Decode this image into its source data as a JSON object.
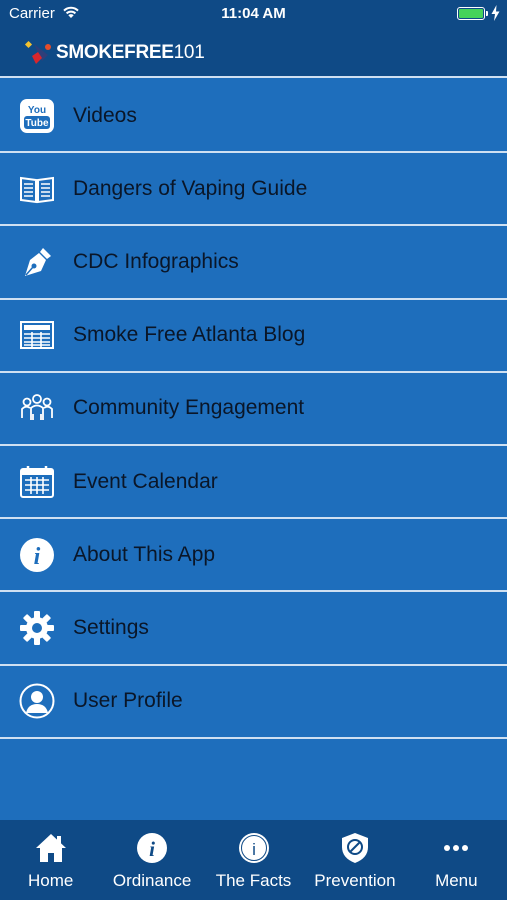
{
  "status_bar": {
    "carrier": "Carrier",
    "time": "11:04 AM",
    "battery_level": 1.0
  },
  "header": {
    "logo_text": "SMOKEFREE101"
  },
  "menu": {
    "items": [
      {
        "label": "Videos",
        "icon": "youtube-icon"
      },
      {
        "label": "Dangers of Vaping Guide",
        "icon": "book-icon"
      },
      {
        "label": "CDC Infographics",
        "icon": "pen-nib-icon"
      },
      {
        "label": "Smoke Free Atlanta Blog",
        "icon": "newspaper-icon"
      },
      {
        "label": "Community Engagement",
        "icon": "people-icon"
      },
      {
        "label": "Event Calendar",
        "icon": "calendar-icon"
      },
      {
        "label": "About This App",
        "icon": "info-icon"
      },
      {
        "label": "Settings",
        "icon": "gear-icon"
      },
      {
        "label": "User Profile",
        "icon": "user-icon"
      }
    ]
  },
  "tab_bar": {
    "tabs": [
      {
        "label": "Home",
        "icon": "home-icon"
      },
      {
        "label": "Ordinance",
        "icon": "info-circle-icon"
      },
      {
        "label": "The Facts",
        "icon": "info-outline-icon"
      },
      {
        "label": "Prevention",
        "icon": "shield-icon"
      },
      {
        "label": "Menu",
        "icon": "more-icon"
      }
    ]
  },
  "colors": {
    "background": "#1e6ebc",
    "bar": "#0f4a86",
    "divider": "#cfe0f2",
    "battery": "#46d35a"
  }
}
